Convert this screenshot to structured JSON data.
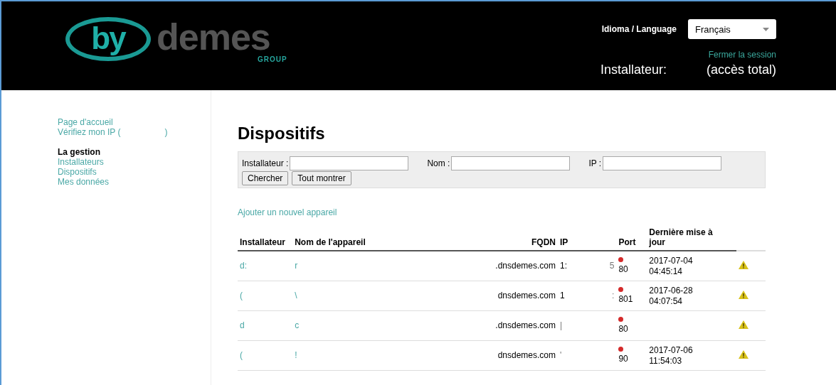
{
  "header": {
    "logo": {
      "mark": "by",
      "name": "demes",
      "sub": "GROUP"
    },
    "language_label": "Idioma / Language",
    "language_select": {
      "value": "Français"
    },
    "logout_link": "Fermer la session",
    "user_label": "Installateur:",
    "access": "(accès total)"
  },
  "sidebar": {
    "links": [
      {
        "label": "Page d'accueil"
      },
      {
        "label": "Vérifiez mon IP (",
        "tail": ")"
      }
    ],
    "section": {
      "title": "La gestion",
      "items": [
        {
          "label": "Installateurs"
        },
        {
          "label": "Dispositifs"
        },
        {
          "label": "Mes données"
        }
      ]
    }
  },
  "main": {
    "title": "Dispositifs",
    "filters": [
      {
        "label": "Installateur :"
      },
      {
        "label": "Nom :"
      },
      {
        "label": "IP :"
      }
    ],
    "buttons": [
      "Chercher",
      "Tout montrer"
    ],
    "add_link": "Ajouter un nouvel appareil",
    "table": {
      "columns": [
        "Installateur",
        "Nom de l'appareil",
        "FQDN",
        "IP",
        "Port",
        "Dernière mise à jour"
      ],
      "rows": [
        {
          "installer": "d:",
          "name": "r",
          "fqdn": ".dnsdemes.com",
          "ip": "1:",
          "ip_tail": "5",
          "color": "#d42a2a",
          "port": "80",
          "date": "2017-07-04",
          "time": "04:45:14",
          "warning": true
        },
        {
          "installer": "(",
          "name": "\\",
          "fqdn": "dnsdemes.com",
          "ip": "1",
          "ip_tail": ":",
          "color": "#d42a2a",
          "port": "801",
          "date": "2017-06-28",
          "time": "04:07:54",
          "warning": true
        },
        {
          "installer": "d",
          "name": "c",
          "fqdn": ".dnsdemes.com",
          "ip_tail": "|",
          "color": "#d42a2a",
          "port": "80",
          "warning": true
        },
        {
          "installer": "(",
          "name": "!",
          "fqdn": "dnsdemes.com",
          "ip_tail": "'",
          "color": "#d42a2a",
          "port": "90",
          "date": "2017-07-06",
          "time": "11:54:03",
          "warning": true
        }
      ]
    }
  }
}
